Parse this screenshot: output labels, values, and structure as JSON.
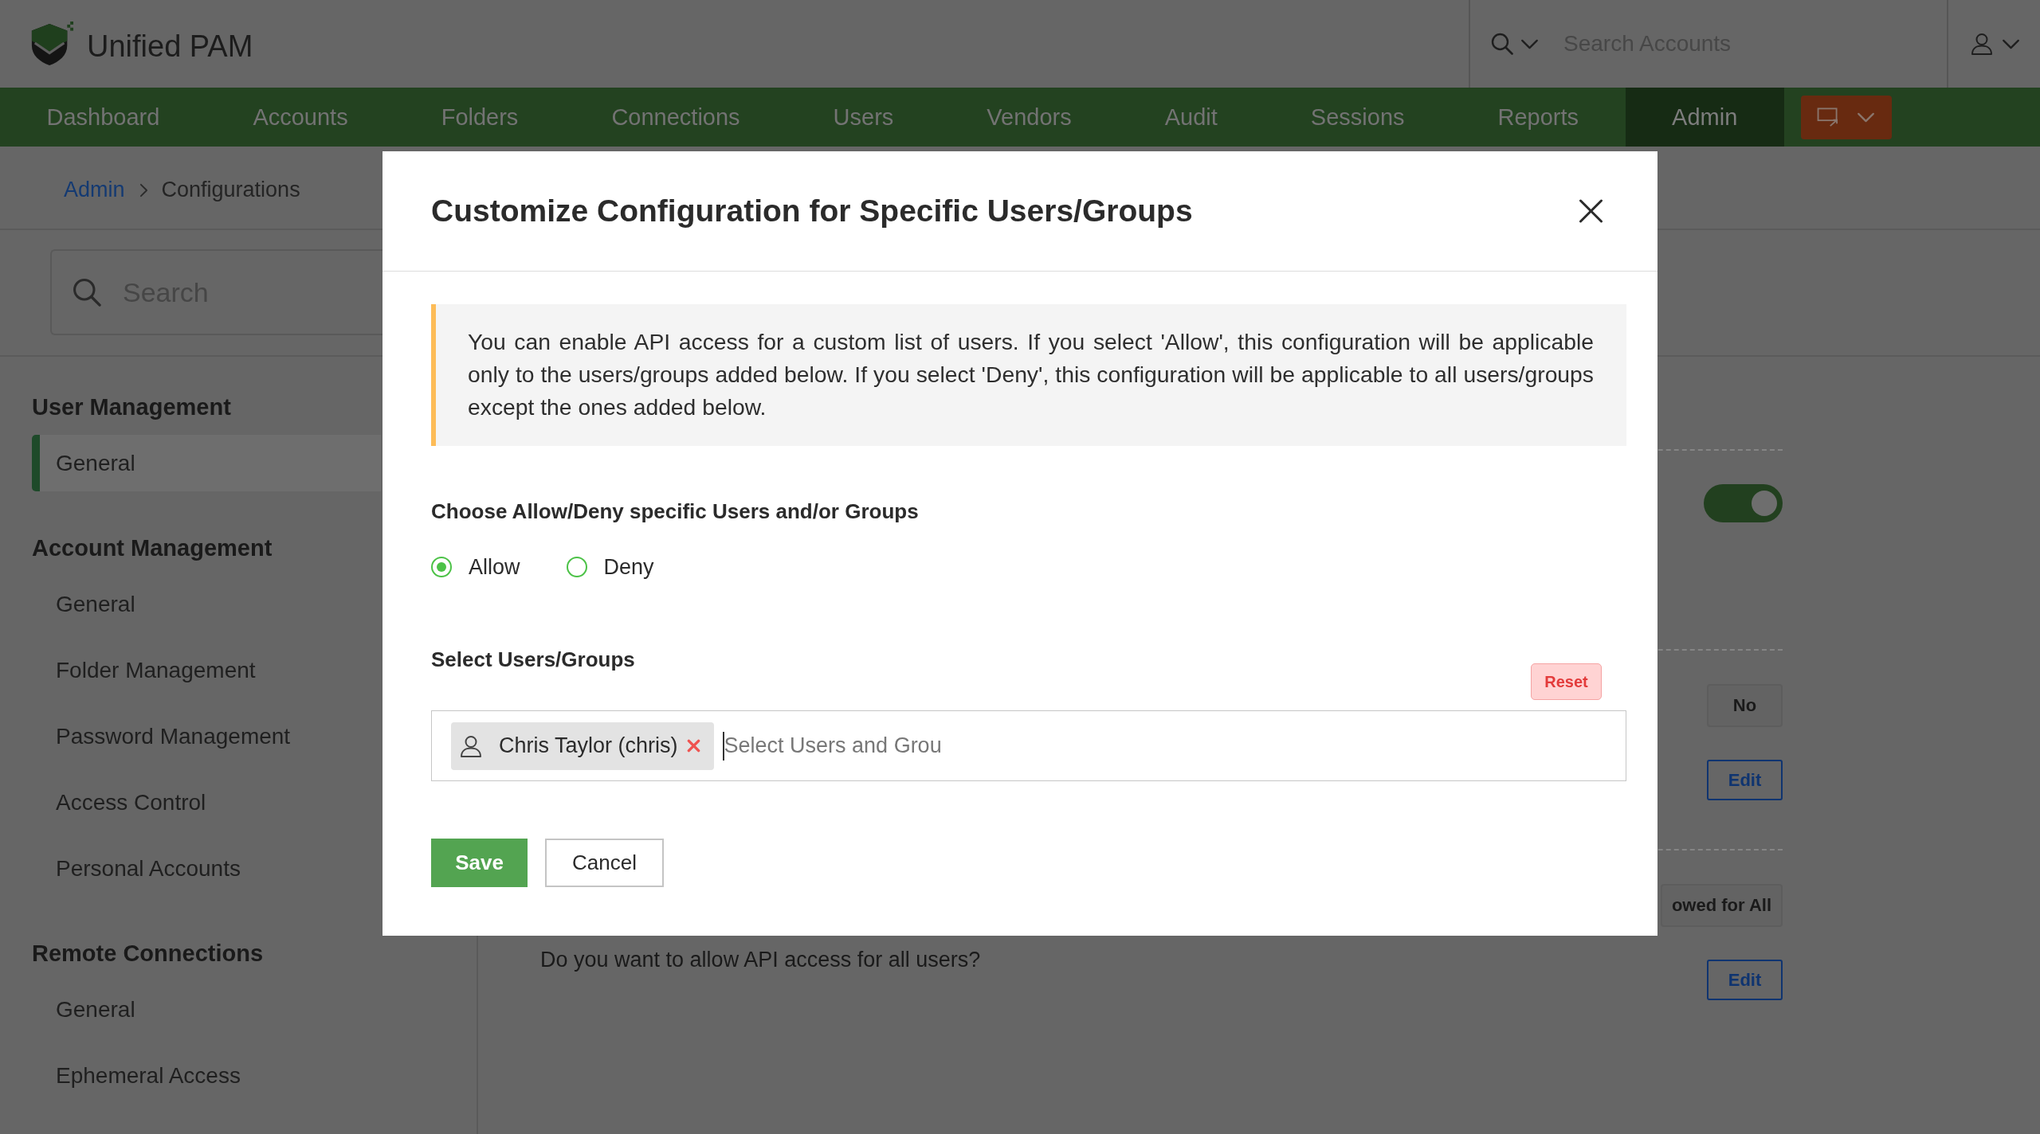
{
  "header": {
    "product_name": "Unified PAM",
    "search": {
      "placeholder": "Search Accounts"
    }
  },
  "nav": {
    "items": [
      {
        "label": "Dashboard",
        "selected": false
      },
      {
        "label": "Accounts",
        "selected": false
      },
      {
        "label": "Folders",
        "selected": false
      },
      {
        "label": "Connections",
        "selected": false
      },
      {
        "label": "Users",
        "selected": false
      },
      {
        "label": "Vendors",
        "selected": false
      },
      {
        "label": "Audit",
        "selected": false
      },
      {
        "label": "Sessions",
        "selected": false
      },
      {
        "label": "Reports",
        "selected": false
      },
      {
        "label": "Admin",
        "selected": true
      }
    ]
  },
  "breadcrumb": [
    {
      "label": "Admin",
      "kind": "link"
    },
    {
      "label": "Configurations",
      "kind": "current"
    }
  ],
  "sidebar": {
    "search": {
      "placeholder": "Search"
    },
    "sections": [
      {
        "title": "User Management",
        "items": [
          {
            "label": "General",
            "selected": true
          }
        ]
      },
      {
        "title": "Account Management",
        "items": [
          {
            "label": "General",
            "selected": false
          },
          {
            "label": "Folder Management",
            "selected": false
          },
          {
            "label": "Password Management",
            "selected": false
          },
          {
            "label": "Access Control",
            "selected": false
          },
          {
            "label": "Personal Accounts",
            "selected": false
          }
        ]
      },
      {
        "title": "Remote Connections",
        "items": [
          {
            "label": "General",
            "selected": false
          },
          {
            "label": "Ephemeral Access",
            "selected": false
          }
        ]
      }
    ]
  },
  "settings": [
    {
      "kind": "toggle",
      "on": true
    },
    {
      "kind": "value",
      "value": "No",
      "action": "Edit"
    },
    {
      "kind": "value",
      "value": "owed for All",
      "question": "Do you want to allow API access for all users?",
      "action": "Edit"
    }
  ],
  "dialog": {
    "title": "Customize Configuration for Specific Users/Groups",
    "notice": "You can enable API access for a custom list of users. If you select 'Allow', this configuration will be applicable only to the users/groups added below. If you select 'Deny', this configuration will be applicable to all users/groups except the ones added below.",
    "mode_label": "Choose Allow/Deny specific Users and/or Groups",
    "modes": [
      {
        "label": "Allow",
        "selected": true
      },
      {
        "label": "Deny",
        "selected": false
      }
    ],
    "picker_label": "Select Users/Groups",
    "reset_label": "Reset",
    "picker": {
      "selected": [
        {
          "label": "Chris Taylor (chris)"
        }
      ],
      "placeholder": "Select Users and Grou"
    },
    "buttons": [
      {
        "label": "Save",
        "kind": "save"
      },
      {
        "label": "Cancel",
        "kind": "cancel"
      }
    ]
  }
}
